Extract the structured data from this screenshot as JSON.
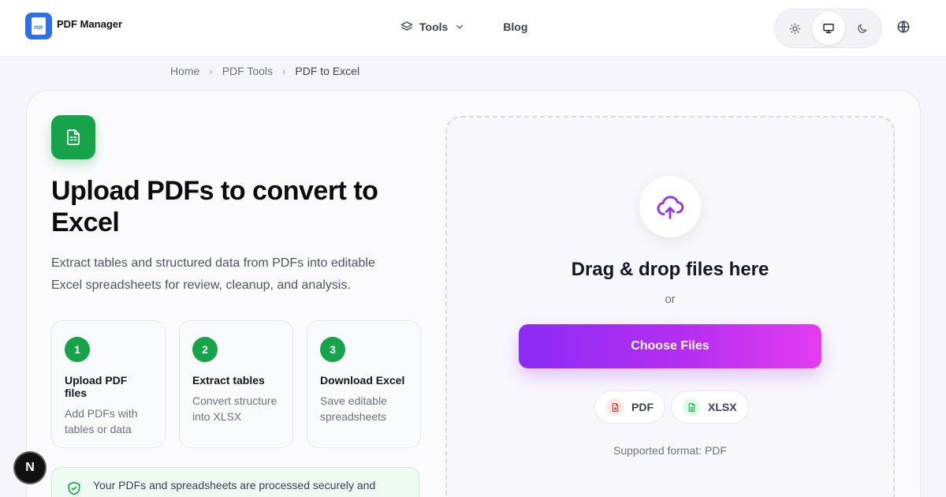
{
  "header": {
    "logo_badge_text": "PDF",
    "brand": "PDF Manager",
    "nav": {
      "tools": "Tools",
      "blog": "Blog"
    }
  },
  "breadcrumb": {
    "home": "Home",
    "section": "PDF Tools",
    "current": "PDF to Excel"
  },
  "hero": {
    "title": "Upload PDFs to convert to Excel",
    "description": "Extract tables and structured data from PDFs into editable Excel spreadsheets for review, cleanup, and analysis."
  },
  "steps": [
    {
      "num": "1",
      "title": "Upload PDF files",
      "desc": "Add PDFs with tables or data"
    },
    {
      "num": "2",
      "title": "Extract tables",
      "desc": "Convert structure into XLSX"
    },
    {
      "num": "3",
      "title": "Download Excel",
      "desc": "Save editable spreadsheets"
    }
  ],
  "security_note": "Your PDFs and spreadsheets are processed securely and",
  "dev_badge": "N",
  "dropzone": {
    "title": "Drag & drop files here",
    "or": "or",
    "button": "Choose Files",
    "formats": [
      "PDF",
      "XLSX"
    ],
    "supported": "Supported format: PDF"
  },
  "colors": {
    "accent_start": "#8b2cf5",
    "accent_end": "#e33df0",
    "success": "#16a34a",
    "brand": "#2f6fe8"
  }
}
